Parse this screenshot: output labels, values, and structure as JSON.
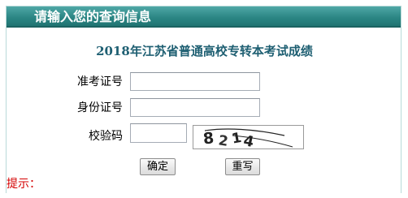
{
  "header": {
    "title": "请输入您的查询信息"
  },
  "exam_title": "2018年江苏省普通高校专转本考试成绩",
  "form": {
    "exam_id": {
      "label": "准考证号",
      "value": ""
    },
    "id_card": {
      "label": "身份证号",
      "value": ""
    },
    "verify_code": {
      "label": "校验码",
      "value": ""
    },
    "captcha": {
      "text": [
        "8",
        "2",
        "1",
        "4"
      ]
    }
  },
  "buttons": {
    "confirm_label": "确定",
    "reset_label": "重写"
  },
  "hint": "提示：",
  "colors": {
    "header_bar": "#2c8785",
    "exam_title": "#1e5f72",
    "hint": "#d40000"
  }
}
